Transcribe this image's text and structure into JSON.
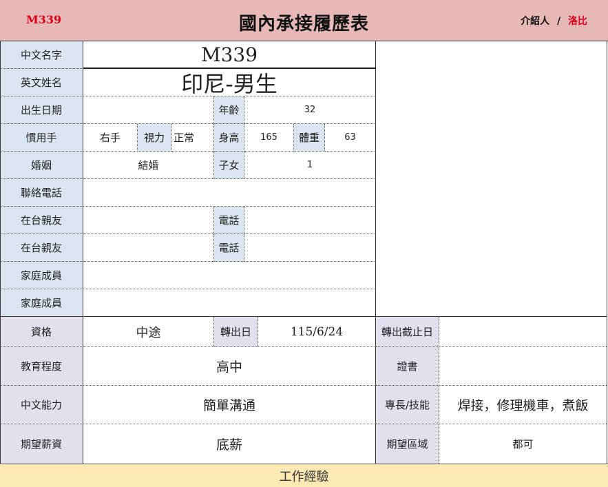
{
  "header": {
    "id_code": "M339",
    "title": "國內承接履歷表",
    "introducer_label": "介紹人",
    "separator": "/",
    "introducer_name": "洛比"
  },
  "form": {
    "chinese_name": {
      "label": "中文名字",
      "value": "M339"
    },
    "english_name": {
      "label": "英文姓名",
      "value": "印尼-男生"
    },
    "birth": {
      "label": "出生日期",
      "value": "",
      "age_label": "年齡",
      "age": "32"
    },
    "hand": {
      "label": "慣用手",
      "value": "右手",
      "vision_label": "視力",
      "vision": "正常",
      "height_label": "身高",
      "height": "165",
      "weight_label": "體重",
      "weight": "63"
    },
    "marriage": {
      "label": "婚姻",
      "value": "結婚",
      "children_label": "子女",
      "children": "1"
    },
    "contact_phone": {
      "label": "聯絡電話",
      "value": ""
    },
    "relative1": {
      "label": "在台親友",
      "value": "",
      "phone_label": "電話",
      "phone": ""
    },
    "relative2": {
      "label": "在台親友",
      "value": "",
      "phone_label": "電話",
      "phone": ""
    },
    "family1": {
      "label": "家庭成員",
      "value": ""
    },
    "family2": {
      "label": "家庭成員",
      "value": ""
    },
    "qualification": {
      "label": "資格",
      "value": "中途",
      "transfer_label": "轉出日",
      "transfer": "115/6/24",
      "deadline_label": "轉出截止日",
      "deadline": ""
    },
    "education": {
      "label": "教育程度",
      "value": "高中",
      "cert_label": "證書",
      "cert": ""
    },
    "chinese_ability": {
      "label": "中文能力",
      "value": "簡單溝通",
      "skill_label": "專長/技能",
      "skill": "焊接，修理機車，煮飯"
    },
    "salary": {
      "label": "期望薪資",
      "value": "底薪",
      "region_label": "期望區域",
      "region": "都可"
    }
  },
  "work_experience": {
    "label": "工作經驗"
  }
}
